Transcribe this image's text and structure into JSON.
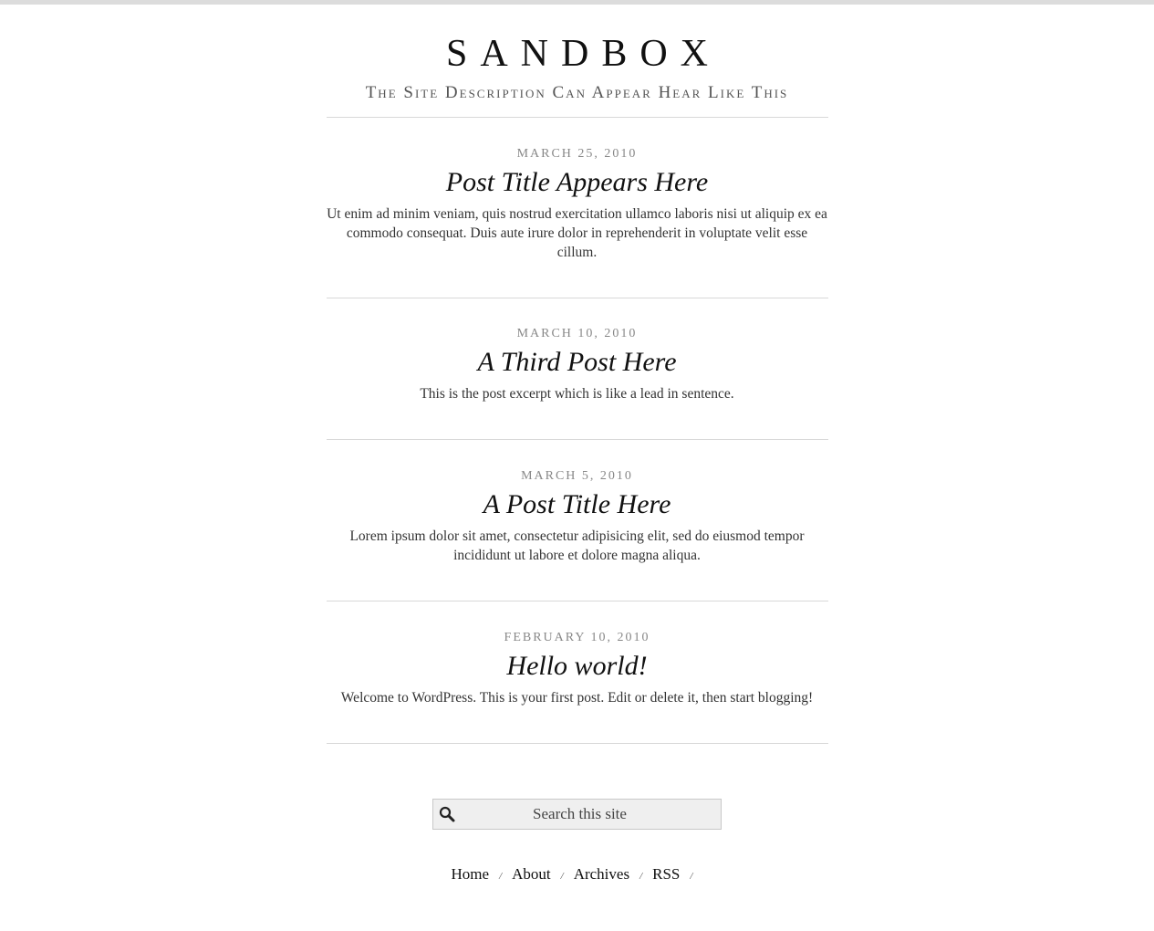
{
  "site": {
    "title": "SANDBOX",
    "description": "The Site Description Can Appear Hear Like This"
  },
  "posts": [
    {
      "date": "MARCH 25, 2010",
      "title": "Post Title Appears Here",
      "excerpt": "Ut enim ad minim veniam, quis nostrud exercitation ullamco laboris nisi ut aliquip ex ea commodo consequat. Duis aute irure dolor in reprehenderit in voluptate velit esse cillum."
    },
    {
      "date": "MARCH 10, 2010",
      "title": "A Third Post Here",
      "excerpt": "This is the post excerpt which is like a lead in sentence."
    },
    {
      "date": "MARCH 5, 2010",
      "title": "A Post Title Here",
      "excerpt": "Lorem ipsum dolor sit amet, consectetur adipisicing elit, sed do eiusmod tempor incididunt ut labore et dolore magna aliqua."
    },
    {
      "date": "FEBRUARY 10, 2010",
      "title": "Hello world!",
      "excerpt": "Welcome to WordPress. This is your first post. Edit or delete it, then start blogging!"
    }
  ],
  "search": {
    "placeholder": "Search this site",
    "icon": "magnifier"
  },
  "footer_nav": {
    "items": [
      {
        "label": "Home"
      },
      {
        "label": "About"
      },
      {
        "label": "Archives"
      },
      {
        "label": "RSS"
      }
    ],
    "separator": "/"
  },
  "colors": {
    "top_bar": "#dcdcdc",
    "search_bg": "#efefef",
    "rule": "#d8d8d8"
  }
}
